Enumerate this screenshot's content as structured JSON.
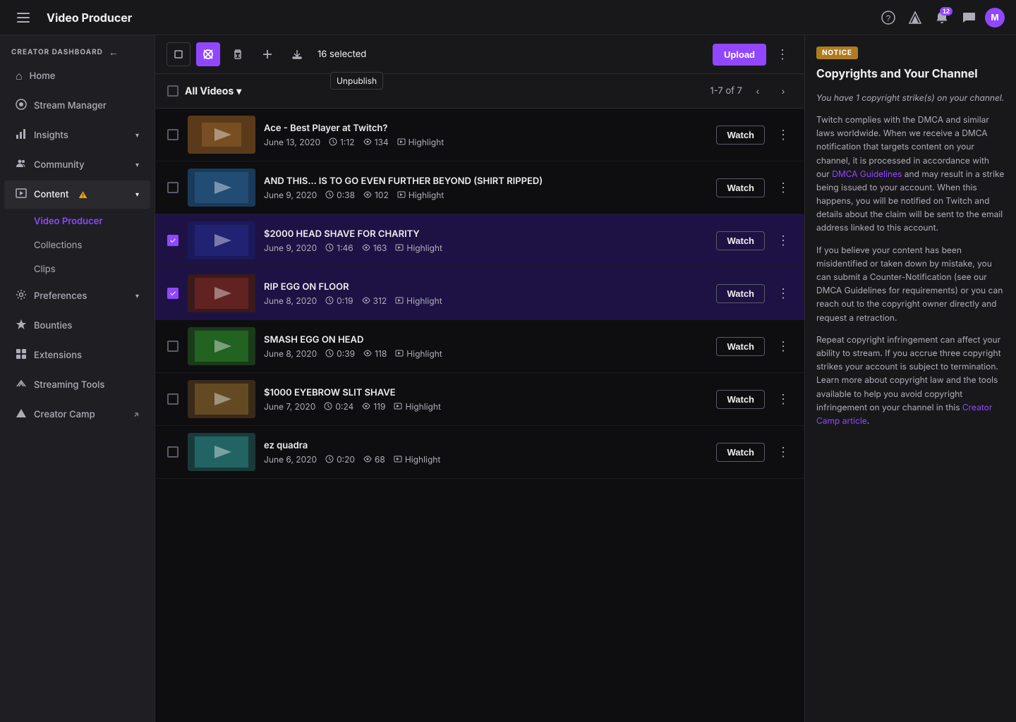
{
  "app": {
    "title": "Video Producer",
    "hamburger_label": "Menu"
  },
  "nav_icons": {
    "help": "?",
    "creator_tools": "◈",
    "notifications": "🔔",
    "notifications_badge": "12",
    "chat": "💬",
    "avatar_initials": "M"
  },
  "sidebar": {
    "section_header": "CREATOR DASHBOARD",
    "back_label": "←",
    "items": [
      {
        "id": "home",
        "label": "Home",
        "icon": "⌂"
      },
      {
        "id": "stream-manager",
        "label": "Stream Manager",
        "icon": "⊕"
      },
      {
        "id": "insights",
        "label": "Insights",
        "icon": "📊",
        "has_chevron": true
      },
      {
        "id": "community",
        "label": "Community",
        "icon": "👥",
        "has_chevron": true
      },
      {
        "id": "content",
        "label": "Content",
        "icon": "🎬",
        "has_chevron": true,
        "has_warning": true
      },
      {
        "id": "preferences",
        "label": "Preferences",
        "icon": "⚙",
        "has_chevron": true
      },
      {
        "id": "bounties",
        "label": "Bounties",
        "icon": "💎"
      },
      {
        "id": "extensions",
        "label": "Extensions",
        "icon": "🧩"
      },
      {
        "id": "streaming-tools",
        "label": "Streaming Tools",
        "icon": "🛠"
      },
      {
        "id": "creator-camp",
        "label": "Creator Camp",
        "icon": "🏕",
        "external": true
      }
    ],
    "sub_items": [
      {
        "id": "video-producer",
        "label": "Video Producer",
        "active": true
      },
      {
        "id": "collections",
        "label": "Collections"
      },
      {
        "id": "clips",
        "label": "Clips"
      }
    ]
  },
  "toolbar": {
    "selected_count": "16 selected",
    "upload_label": "Upload",
    "unpublish_tooltip": "Unpublish",
    "more_options_label": "⋮"
  },
  "video_list": {
    "header_label": "All Videos",
    "pagination": "1-7 of 7",
    "videos": [
      {
        "id": 1,
        "title": "Ace - Best Player at Twitch?",
        "date": "June 13, 2020",
        "duration": "1:12",
        "views": "134",
        "type": "Highlight",
        "selected": false,
        "thumb_class": "thumb-1"
      },
      {
        "id": 2,
        "title": "AND THIS... IS TO GO EVEN FURTHER BEYOND (SHIRT RIPPED)",
        "date": "June 9, 2020",
        "duration": "0:38",
        "views": "102",
        "type": "Highlight",
        "selected": false,
        "thumb_class": "thumb-2"
      },
      {
        "id": 3,
        "title": "$2000 HEAD SHAVE FOR CHARITY",
        "date": "June 9, 2020",
        "duration": "1:46",
        "views": "163",
        "type": "Highlight",
        "selected": true,
        "thumb_class": "thumb-3"
      },
      {
        "id": 4,
        "title": "RIP EGG ON FLOOR",
        "date": "June 8, 2020",
        "duration": "0:19",
        "views": "312",
        "type": "Highlight",
        "selected": true,
        "thumb_class": "thumb-4"
      },
      {
        "id": 5,
        "title": "SMASH EGG ON HEAD",
        "date": "June 8, 2020",
        "duration": "0:39",
        "views": "118",
        "type": "Highlight",
        "selected": false,
        "thumb_class": "thumb-5"
      },
      {
        "id": 6,
        "title": "$1000 EYEBROW SLIT SHAVE",
        "date": "June 7, 2020",
        "duration": "0:24",
        "views": "119",
        "type": "Highlight",
        "selected": false,
        "thumb_class": "thumb-6"
      },
      {
        "id": 7,
        "title": "ez quadra",
        "date": "June 6, 2020",
        "duration": "0:20",
        "views": "68",
        "type": "Highlight",
        "selected": false,
        "thumb_class": "thumb-7"
      }
    ],
    "watch_label": "Watch"
  },
  "notice": {
    "badge": "NOTICE",
    "title": "Copyrights and Your Channel",
    "paragraphs": [
      "You have 1 copyright strike(s) on your channel.",
      "Twitch complies with the DMCA and similar laws worldwide. When we receive a DMCA notification that targets content on your channel, it is processed in accordance with our DMCA Guidelines and may result in a strike being issued to your account. When this happens, you will be notified on Twitch and details about the claim will be sent to the email address linked to this account.",
      "If you believe your content has been misidentified or taken down by mistake, you can submit a Counter-Notification (see our DMCA Guidelines for requirements) or you can reach out to the copyright owner directly and request a retraction.",
      "Repeat copyright infringement can affect your ability to stream. If you accrue three copyright strikes your account is subject to termination. Learn more about copyright law and the tools available to help you avoid copyright infringement on your channel in this Creator Camp article."
    ],
    "dmca_link_text": "DMCA Guidelines",
    "creator_camp_link_text": "Creator Camp article"
  }
}
